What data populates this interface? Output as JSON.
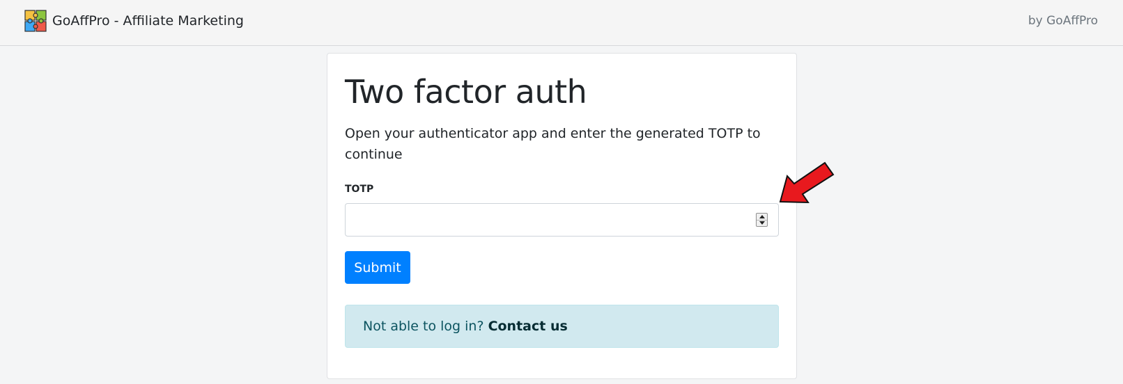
{
  "header": {
    "brand_name": "GoAffPro - Affiliate Marketing",
    "byline": "by GoAffPro",
    "logo_icon": "puzzle-icon"
  },
  "card": {
    "title": "Two factor auth",
    "description": "Open your authenticator app and enter the generated TOTP to continue",
    "totp_label": "TOTP",
    "totp_value": "",
    "submit_label": "Submit",
    "help_text": "Not able to log in?",
    "help_link": "Contact us"
  },
  "colors": {
    "primary": "#0080ff",
    "alert_background": "#d1e9ef",
    "annotation_arrow": "#e8191e"
  }
}
